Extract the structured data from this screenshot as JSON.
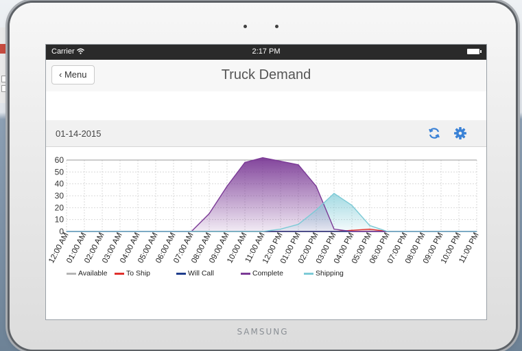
{
  "device": {
    "brand": "SAMSUNG"
  },
  "status_bar": {
    "carrier": "Carrier",
    "time": "2:17 PM"
  },
  "nav": {
    "back_label": "Menu",
    "title": "Truck Demand"
  },
  "toolbar": {
    "date": "01-14-2015",
    "icons": [
      "refresh-icon",
      "gear-icon"
    ],
    "accent": "#3b82d6"
  },
  "chart_data": {
    "type": "area",
    "categories": [
      "12:00 AM",
      "01:00 AM",
      "02:00 AM",
      "03:00 AM",
      "04:00 AM",
      "05:00 AM",
      "06:00 AM",
      "07:00 AM",
      "08:00 AM",
      "09:00 AM",
      "10:00 AM",
      "11:00 AM",
      "12:00 PM",
      "01:00 PM",
      "02:00 PM",
      "03:00 PM",
      "04:00 PM",
      "05:00 PM",
      "06:00 PM",
      "07:00 PM",
      "08:00 PM",
      "09:00 PM",
      "10:00 PM",
      "11:00 PM"
    ],
    "ylim": [
      0,
      60
    ],
    "yticks": [
      0,
      10,
      20,
      30,
      40,
      50,
      60
    ],
    "grid": true,
    "legend_position": "bottom-left",
    "series": [
      {
        "name": "Available",
        "color": "#b5b5b5",
        "values": [
          0,
          0,
          0,
          0,
          0,
          0,
          0,
          0,
          0,
          0,
          0,
          0,
          0,
          0,
          0,
          0,
          0,
          0,
          0,
          0,
          0,
          0,
          0,
          0
        ]
      },
      {
        "name": "To Ship",
        "color": "#e0302c",
        "values": [
          0,
          0,
          0,
          0,
          0,
          0,
          0,
          0,
          0,
          0,
          0,
          0,
          0,
          0,
          0,
          0,
          1,
          2,
          0,
          0,
          0,
          0,
          0,
          0
        ]
      },
      {
        "name": "Will Call",
        "color": "#1f3d8c",
        "values": [
          0,
          0,
          0,
          0,
          0,
          0,
          0,
          0,
          0,
          0,
          0,
          0,
          0,
          0,
          0,
          0,
          0,
          0,
          0,
          0,
          0,
          0,
          0,
          0
        ]
      },
      {
        "name": "Complete",
        "color": "#7b3a96",
        "values": [
          0,
          0,
          0,
          0,
          0,
          0,
          0,
          0,
          15,
          38,
          58,
          62,
          59,
          56,
          38,
          2,
          0,
          0,
          0,
          0,
          0,
          0,
          0,
          0
        ]
      },
      {
        "name": "Shipping",
        "color": "#7ccad6",
        "values": [
          0,
          0,
          0,
          0,
          0,
          0,
          0,
          0,
          0,
          0,
          0,
          0,
          2,
          6,
          18,
          32,
          22,
          5,
          0,
          0,
          0,
          0,
          0,
          0
        ]
      }
    ]
  }
}
